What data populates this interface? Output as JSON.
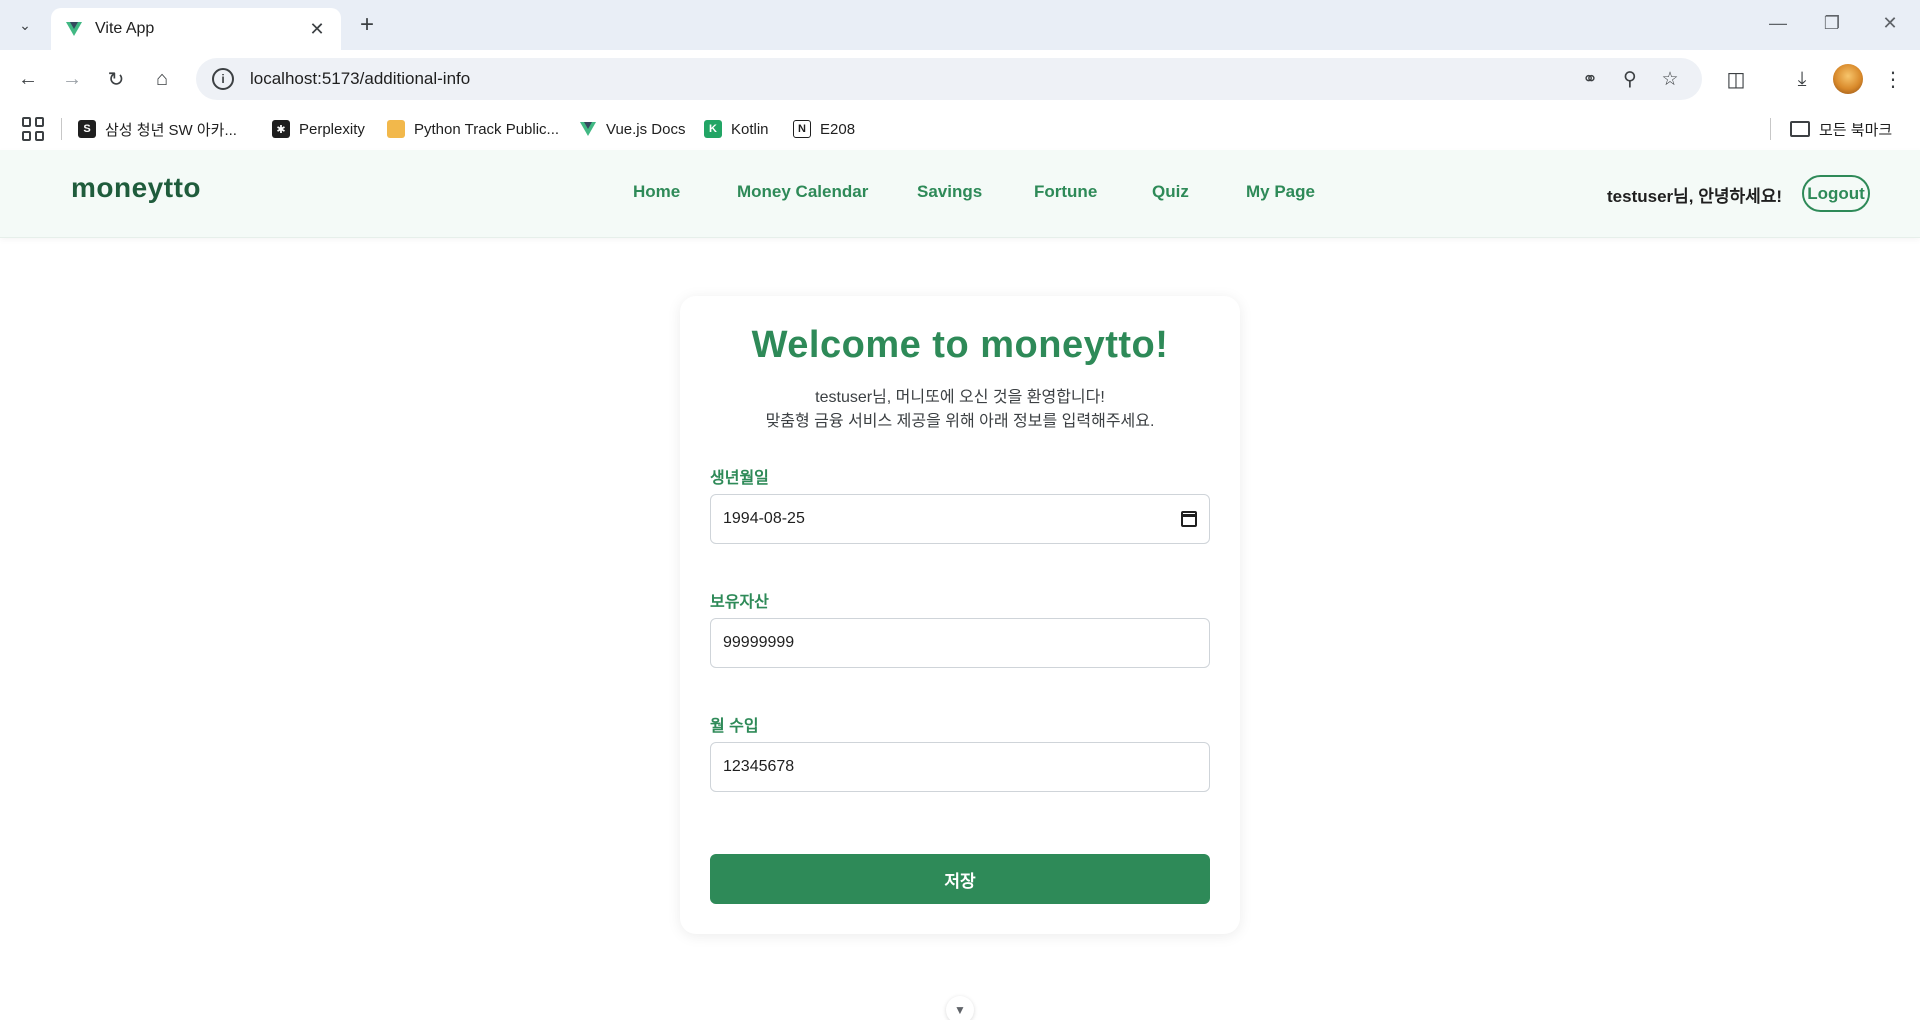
{
  "browser": {
    "tab_title": "Vite App",
    "url": "localhost:5173/additional-info",
    "bookmarks": [
      {
        "label": "삼성 청년 SW 아카...",
        "icon": "samsung-sw-icon",
        "color": "#1f1f1f"
      },
      {
        "label": "Perplexity",
        "icon": "perplexity-icon",
        "color": "#1f1f1f"
      },
      {
        "label": "Python Track Public...",
        "icon": "notepad-icon",
        "color": "#f2b84b"
      },
      {
        "label": "Vue.js Docs",
        "icon": "vue-icon",
        "color": "#41b883"
      },
      {
        "label": "Kotlin",
        "icon": "kotlin-icon",
        "color": "#22a565"
      },
      {
        "label": "E208",
        "icon": "notion-icon",
        "color": "#1f1f1f"
      }
    ],
    "all_bookmarks_label": "모든 북마크"
  },
  "header": {
    "brand": "moneytto",
    "nav": [
      {
        "label": "Home"
      },
      {
        "label": "Money Calendar"
      },
      {
        "label": "Savings"
      },
      {
        "label": "Fortune"
      },
      {
        "label": "Quiz"
      },
      {
        "label": "My Page"
      }
    ],
    "greeting": "testuser님, 안녕하세요!",
    "logout_label": "Logout"
  },
  "form": {
    "title": "Welcome to moneytto!",
    "subtitle_line1": "testuser님, 머니또에 오신 것을 환영합니다!",
    "subtitle_line2": "맞춤형 금융 서비스 제공을 위해 아래 정보를 입력해주세요.",
    "birth_label": "생년월일",
    "birth_value": "1994-08-25",
    "assets_label": "보유자산",
    "assets_value": "99999999",
    "income_label": "월 수입",
    "income_value": "12345678",
    "save_label": "저장"
  },
  "colors": {
    "accent": "#2e8a58",
    "brand": "#1f5c3c",
    "header_bg": "#f4faf7"
  }
}
